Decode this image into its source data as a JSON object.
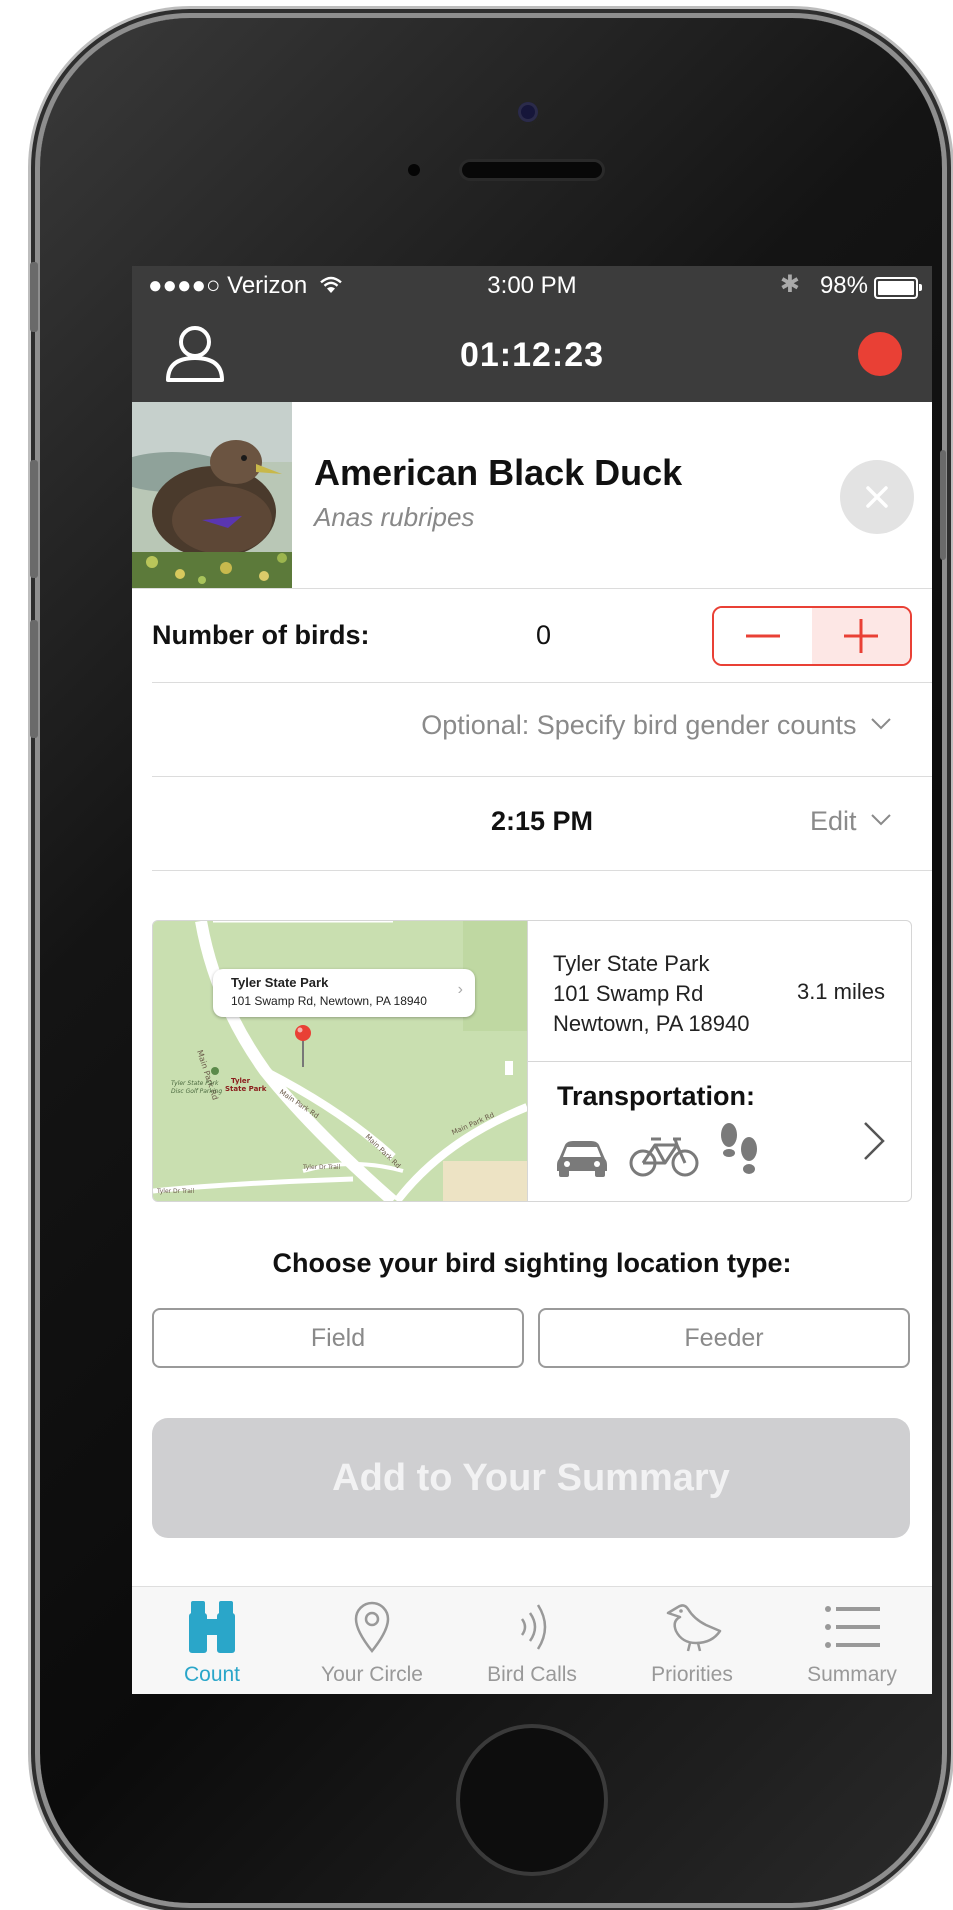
{
  "status_bar": {
    "carrier": "●●●●○ Verizon",
    "time": "3:00 PM",
    "battery": "98%",
    "battery_level": 0.98
  },
  "header": {
    "timer": "01:12:23",
    "icons": [
      "profile-icon",
      "record-icon"
    ],
    "record_color": "#e94035"
  },
  "species": {
    "common_name": "American Black Duck",
    "scientific_name": "Anas rubripes"
  },
  "count": {
    "label": "Number of birds:",
    "value": "0"
  },
  "gender": {
    "text": "Optional:  Specify bird gender counts"
  },
  "sighting_time": {
    "value": "2:15 PM",
    "edit_label": "Edit"
  },
  "location": {
    "callout_name": "Tyler State Park",
    "callout_address": "101 Swamp Rd, Newtown, PA 18940",
    "name": "Tyler State Park",
    "street": "101 Swamp Rd",
    "city": "Newtown, PA 18940",
    "distance": "3.1 miles",
    "map_labels": [
      "Main Park Rd",
      "Tyler State Park",
      "Main Park Rd",
      "Main Park Rd",
      "Tyler Dr Trail",
      "Tyler State Park Disc Golf Parking"
    ],
    "transportation_label": "Transportation:",
    "transport_icons": [
      "car-icon",
      "bicycle-icon",
      "footprints-icon"
    ]
  },
  "location_type": {
    "prompt": "Choose your bird sighting location type:",
    "options": [
      "Field",
      "Feeder"
    ]
  },
  "add_button": "Add to Your Summary",
  "tabs": [
    {
      "label": "Count",
      "icon": "binoculars-icon",
      "active": true
    },
    {
      "label": "Your Circle",
      "icon": "map-pin-icon",
      "active": false
    },
    {
      "label": "Bird Calls",
      "icon": "sound-waves-icon",
      "active": false
    },
    {
      "label": "Priorities",
      "icon": "bird-icon",
      "active": false
    },
    {
      "label": "Summary",
      "icon": "list-icon",
      "active": false
    }
  ],
  "colors": {
    "accent": "#e94035",
    "tab_active": "#2aa6c9",
    "navbar": "#3c3c3c"
  }
}
